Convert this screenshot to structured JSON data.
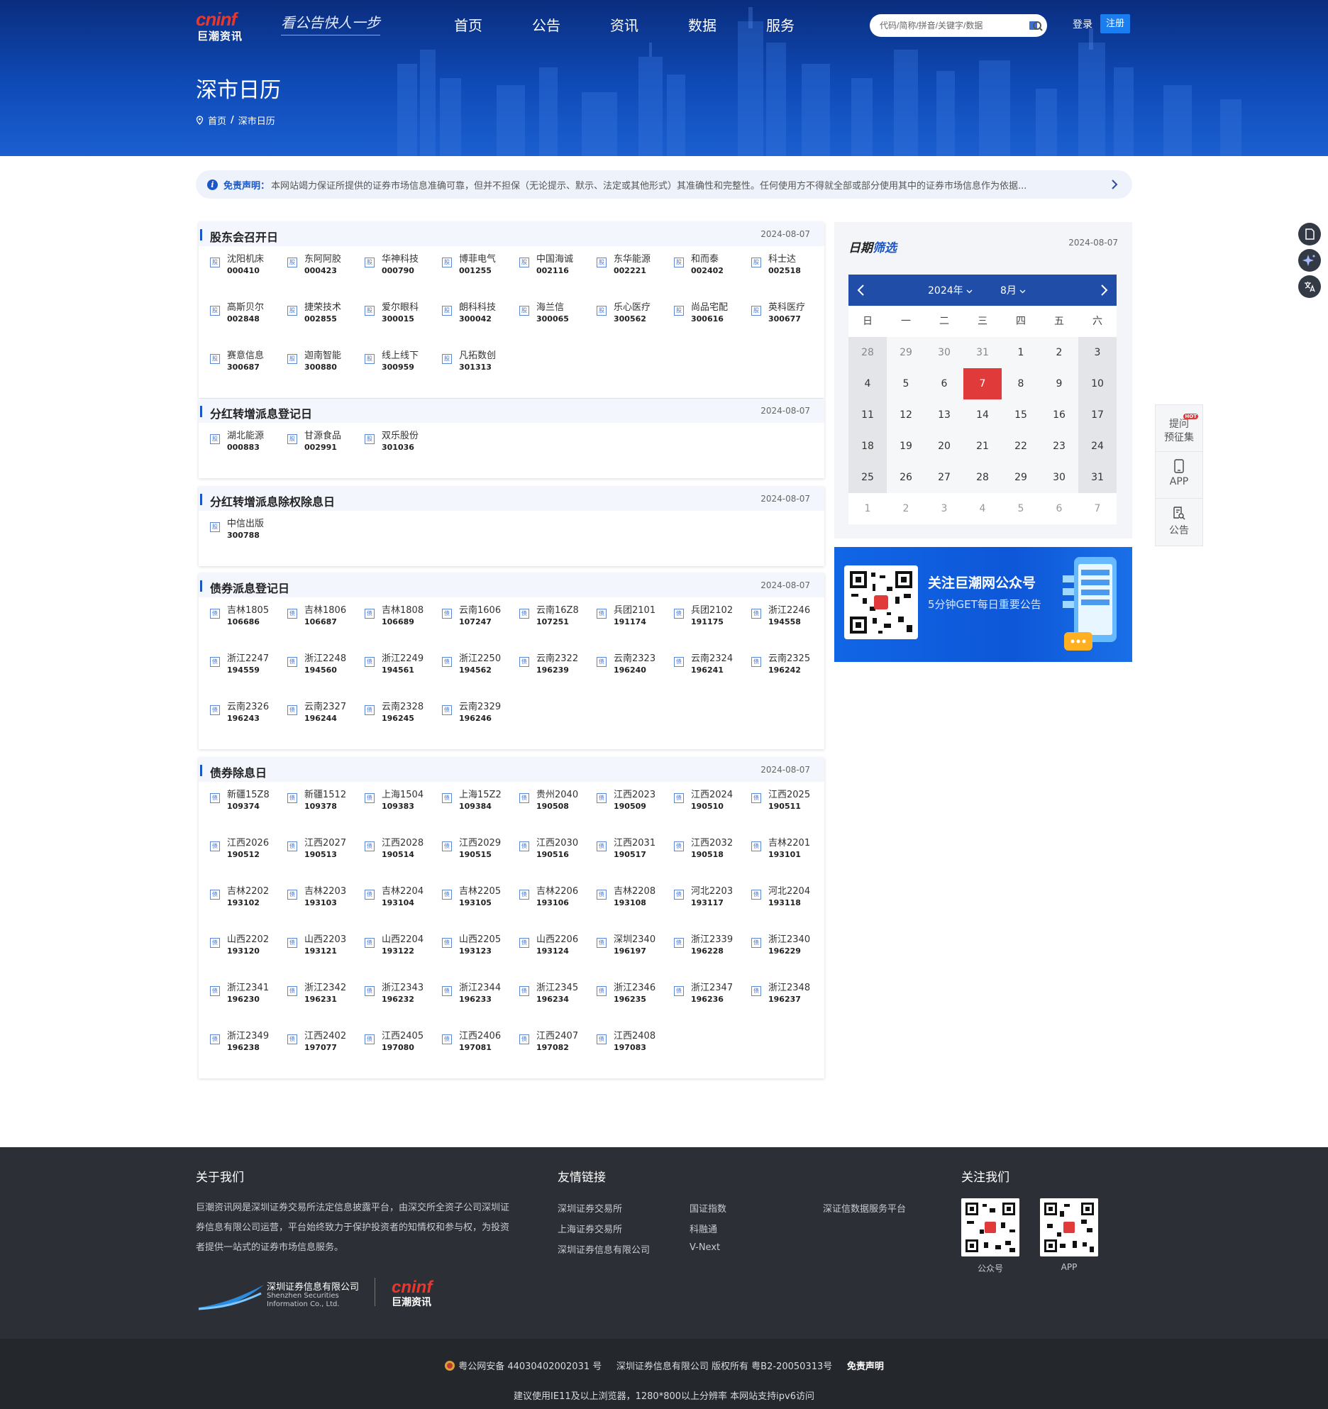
{
  "header": {
    "logo_en": "cninf",
    "logo_cn": "巨潮资讯",
    "slogan": "看公告快人一步",
    "nav": [
      "首页",
      "公告",
      "资讯",
      "数据",
      "服务"
    ],
    "search_placeholder": "代码/简称/拼音/关键字/数据",
    "login": "登录",
    "register": "注册",
    "page_title": "深市日历",
    "breadcrumb_home": "首页",
    "breadcrumb_sep": "/",
    "breadcrumb_current": "深市日历"
  },
  "notice": {
    "label": "免责声明：",
    "text": "本网站竭力保证所提供的证券市场信息准确可靠，但并不担保（无论提示、默示、法定或其他形式）其准确性和完整性。任何使用方不得就全部或部分使用其中的证券市场信息作为依据..."
  },
  "sections": [
    {
      "name": "股东会召开日",
      "date": "2024-08-07",
      "icon": "股",
      "items": [
        [
          "沈阳机床",
          "000410"
        ],
        [
          "东阿阿胶",
          "000423"
        ],
        [
          "华神科技",
          "000790"
        ],
        [
          "博菲电气",
          "001255"
        ],
        [
          "中国海诚",
          "002116"
        ],
        [
          "东华能源",
          "002221"
        ],
        [
          "和而泰",
          "002402"
        ],
        [
          "科士达",
          "002518"
        ],
        [
          "高斯贝尔",
          "002848"
        ],
        [
          "捷荣技术",
          "002855"
        ],
        [
          "爱尔眼科",
          "300015"
        ],
        [
          "朗科科技",
          "300042"
        ],
        [
          "海兰信",
          "300065"
        ],
        [
          "乐心医疗",
          "300562"
        ],
        [
          "尚品宅配",
          "300616"
        ],
        [
          "英科医疗",
          "300677"
        ],
        [
          "赛意信息",
          "300687"
        ],
        [
          "迦南智能",
          "300880"
        ],
        [
          "线上线下",
          "300959"
        ],
        [
          "凡拓数创",
          "301313"
        ]
      ]
    },
    {
      "name": "分红转增派息登记日",
      "date": "2024-08-07",
      "icon": "股",
      "items": [
        [
          "湖北能源",
          "000883"
        ],
        [
          "甘源食品",
          "002991"
        ],
        [
          "双乐股份",
          "301036"
        ]
      ]
    },
    {
      "name": "分红转增派息除权除息日",
      "date": "2024-08-07",
      "icon": "股",
      "items": [
        [
          "中信出版",
          "300788"
        ]
      ]
    },
    {
      "name": "债券派息登记日",
      "date": "2024-08-07",
      "icon": "债",
      "items": [
        [
          "吉林1805",
          "106686"
        ],
        [
          "吉林1806",
          "106687"
        ],
        [
          "吉林1808",
          "106689"
        ],
        [
          "云南1606",
          "107247"
        ],
        [
          "云南16Z8",
          "107251"
        ],
        [
          "兵团2101",
          "191174"
        ],
        [
          "兵团2102",
          "191175"
        ],
        [
          "浙江2246",
          "194558"
        ],
        [
          "浙江2247",
          "194559"
        ],
        [
          "浙江2248",
          "194560"
        ],
        [
          "浙江2249",
          "194561"
        ],
        [
          "浙江2250",
          "194562"
        ],
        [
          "云南2322",
          "196239"
        ],
        [
          "云南2323",
          "196240"
        ],
        [
          "云南2324",
          "196241"
        ],
        [
          "云南2325",
          "196242"
        ],
        [
          "云南2326",
          "196243"
        ],
        [
          "云南2327",
          "196244"
        ],
        [
          "云南2328",
          "196245"
        ],
        [
          "云南2329",
          "196246"
        ]
      ]
    },
    {
      "name": "债券除息日",
      "date": "2024-08-07",
      "icon": "债",
      "items": [
        [
          "新疆15Z8",
          "109374"
        ],
        [
          "新疆1512",
          "109378"
        ],
        [
          "上海1504",
          "109383"
        ],
        [
          "上海15Z2",
          "109384"
        ],
        [
          "贵州2040",
          "190508"
        ],
        [
          "江西2023",
          "190509"
        ],
        [
          "江西2024",
          "190510"
        ],
        [
          "江西2025",
          "190511"
        ],
        [
          "江西2026",
          "190512"
        ],
        [
          "江西2027",
          "190513"
        ],
        [
          "江西2028",
          "190514"
        ],
        [
          "江西2029",
          "190515"
        ],
        [
          "江西2030",
          "190516"
        ],
        [
          "江西2031",
          "190517"
        ],
        [
          "江西2032",
          "190518"
        ],
        [
          "吉林2201",
          "193101"
        ],
        [
          "吉林2202",
          "193102"
        ],
        [
          "吉林2203",
          "193103"
        ],
        [
          "吉林2204",
          "193104"
        ],
        [
          "吉林2205",
          "193105"
        ],
        [
          "吉林2206",
          "193106"
        ],
        [
          "吉林2208",
          "193108"
        ],
        [
          "河北2203",
          "193117"
        ],
        [
          "河北2204",
          "193118"
        ],
        [
          "山西2202",
          "193120"
        ],
        [
          "山西2203",
          "193121"
        ],
        [
          "山西2204",
          "193122"
        ],
        [
          "山西2205",
          "193123"
        ],
        [
          "山西2206",
          "193124"
        ],
        [
          "深圳2340",
          "196197"
        ],
        [
          "浙江2339",
          "196228"
        ],
        [
          "浙江2340",
          "196229"
        ],
        [
          "浙江2341",
          "196230"
        ],
        [
          "浙江2342",
          "196231"
        ],
        [
          "浙江2343",
          "196232"
        ],
        [
          "浙江2344",
          "196233"
        ],
        [
          "浙江2345",
          "196234"
        ],
        [
          "浙江2346",
          "196235"
        ],
        [
          "浙江2347",
          "196236"
        ],
        [
          "浙江2348",
          "196237"
        ],
        [
          "浙江2349",
          "196238"
        ],
        [
          "江西2402",
          "197077"
        ],
        [
          "江西2405",
          "197080"
        ],
        [
          "江西2406",
          "197081"
        ],
        [
          "江西2407",
          "197082"
        ],
        [
          "江西2408",
          "197083"
        ]
      ]
    }
  ],
  "calendar": {
    "title_a": "日期",
    "title_b": "筛选",
    "date": "2024-08-07",
    "year": "2024年",
    "month": "8月",
    "weekdays": [
      "日",
      "一",
      "二",
      "三",
      "四",
      "五",
      "六"
    ],
    "today": "7",
    "weeks": [
      [
        "28",
        "29",
        "30",
        "31",
        "1",
        "2",
        "3"
      ],
      [
        "4",
        "5",
        "6",
        "7",
        "8",
        "9",
        "10"
      ],
      [
        "11",
        "12",
        "13",
        "14",
        "15",
        "16",
        "17"
      ],
      [
        "18",
        "19",
        "20",
        "21",
        "22",
        "23",
        "24"
      ],
      [
        "25",
        "26",
        "27",
        "28",
        "29",
        "30",
        "31"
      ],
      [
        "1",
        "2",
        "3",
        "4",
        "5",
        "6",
        "7"
      ]
    ]
  },
  "banner": {
    "title": "关注巨潮网公众号",
    "subtitle": "5分钟GET每日重要公告"
  },
  "sidebar": {
    "item1": "提问\n预征集",
    "hot": "HOT",
    "item2": "APP",
    "item3": "公告"
  },
  "footer": {
    "about_title": "关于我们",
    "about_text": "巨潮资讯网是深圳证券交易所法定信息披露平台，由深交所全资子公司深圳证券信息有限公司运营，平台始终致力于保护投资者的知情权和参与权，为投资者提供一站式的证券市场信息服务。",
    "links_title": "友情链接",
    "links": [
      "深圳证券交易所",
      "上海证券交易所",
      "深圳证券信息有限公司",
      "国证指数",
      "科融通",
      "V-Next",
      "深证信数据服务平台"
    ],
    "follow_title": "关注我们",
    "qr1": "公众号",
    "qr2": "APP",
    "company_cn": "深圳证券信息有限公司",
    "company_en1": "Shenzhen Securities",
    "company_en2": "Information Co., Ltd.",
    "logo_en": "cninf",
    "logo_cn": "巨潮资讯"
  },
  "bottom": {
    "icp": "粤公网安备 44030402002031 号",
    "copyright": "深圳证券信息有限公司 版权所有 粤B2-20050313号",
    "disclaimer": "免责声明",
    "browser": "建议使用IE11及以上浏览器，1280*800以上分辨率 本网站支持ipv6访问"
  }
}
